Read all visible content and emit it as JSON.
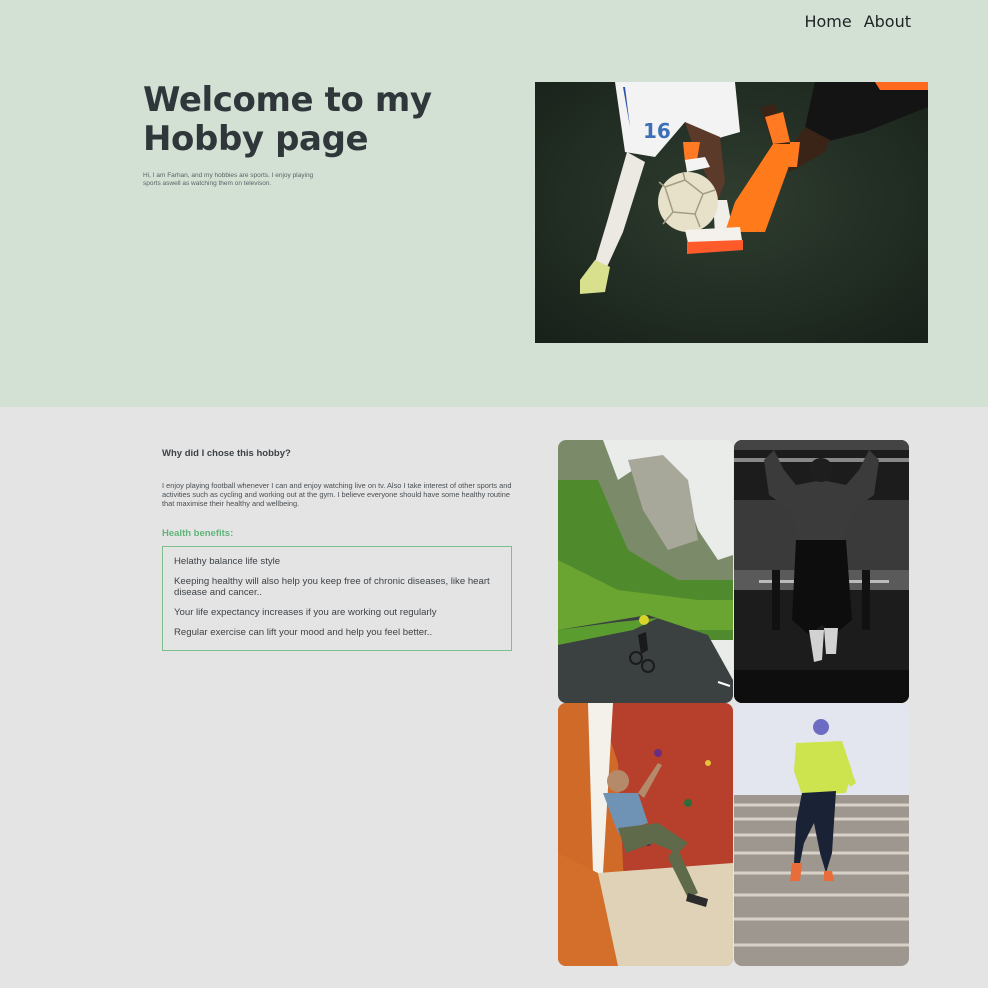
{
  "nav": {
    "home": "Home",
    "about": "About"
  },
  "hero": {
    "title": "Welcome to my Hobby page",
    "intro": "Hi, I am Farhan, and my hobbies are sports. I enjoy playing sports aswell as watching them on televison.",
    "photo_icon": "football-players-photo",
    "jersey_number": "16"
  },
  "why": {
    "title": "Why did I chose this hobby?",
    "text": "I enjoy playing football whenever I can and enjoy watching live on tv. Also I take interest of other sports and activities such as cycling and working out at the gym. I believe everyone should have some healthy routine that maximise their healthy and wellbeing."
  },
  "benefits": {
    "title": "Health benefits:",
    "items": [
      "Helathy balance life style",
      "Keeping healthy will also help you keep free of chronic diseases, like heart disease and cancer..",
      "Your life expectancy increases if you are working out regularly",
      "Regular exercise can lift your mood and help you feel better.."
    ]
  },
  "gallery": {
    "images": [
      "cycling-photo",
      "pull-up-photo",
      "climbing-photo",
      "stair-running-photo"
    ]
  },
  "colors": {
    "hero_bg": "#d3e1d5",
    "page_bg": "#e4e4e4",
    "accent": "#5fb57a"
  }
}
